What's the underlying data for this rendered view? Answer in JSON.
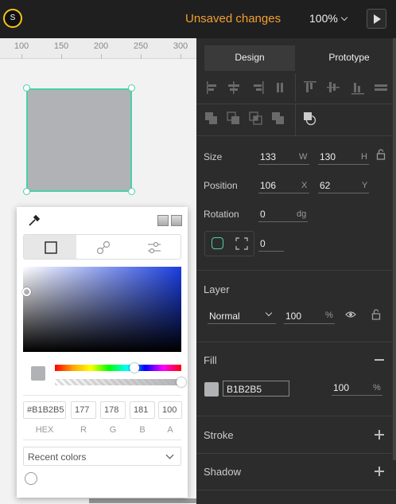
{
  "topbar": {
    "logo": "S",
    "status": "Unsaved changes",
    "zoom": "100%",
    "play_icon": "play-icon"
  },
  "ruler": {
    "ticks": [
      "100",
      "150",
      "200",
      "250",
      "300"
    ]
  },
  "shape": {
    "fill": "#B1B2B5",
    "selection_color": "#4CD0A8"
  },
  "picker": {
    "hex": "#B1B2B5",
    "r": "177",
    "g": "178",
    "b": "181",
    "a": "100",
    "labels": {
      "hex": "HEX",
      "r": "R",
      "g": "G",
      "b": "B",
      "a": "A"
    },
    "recent": "Recent colors"
  },
  "panel": {
    "tabs": {
      "design": "Design",
      "prototype": "Prototype"
    },
    "size": {
      "label": "Size",
      "w": "133",
      "w_unit": "W",
      "h": "130",
      "h_unit": "H"
    },
    "position": {
      "label": "Position",
      "x": "106",
      "x_unit": "X",
      "y": "62",
      "y_unit": "Y"
    },
    "rotation": {
      "label": "Rotation",
      "value": "0",
      "unit": "dg"
    },
    "radius": {
      "value": "0"
    },
    "layer": {
      "title": "Layer",
      "blend": "Normal",
      "opacity": "100",
      "unit": "%"
    },
    "fill": {
      "title": "Fill",
      "hex": "B1B2B5",
      "opacity": "100",
      "unit": "%",
      "color": "#B1B2B5"
    },
    "stroke": {
      "title": "Stroke"
    },
    "shadow": {
      "title": "Shadow"
    }
  }
}
